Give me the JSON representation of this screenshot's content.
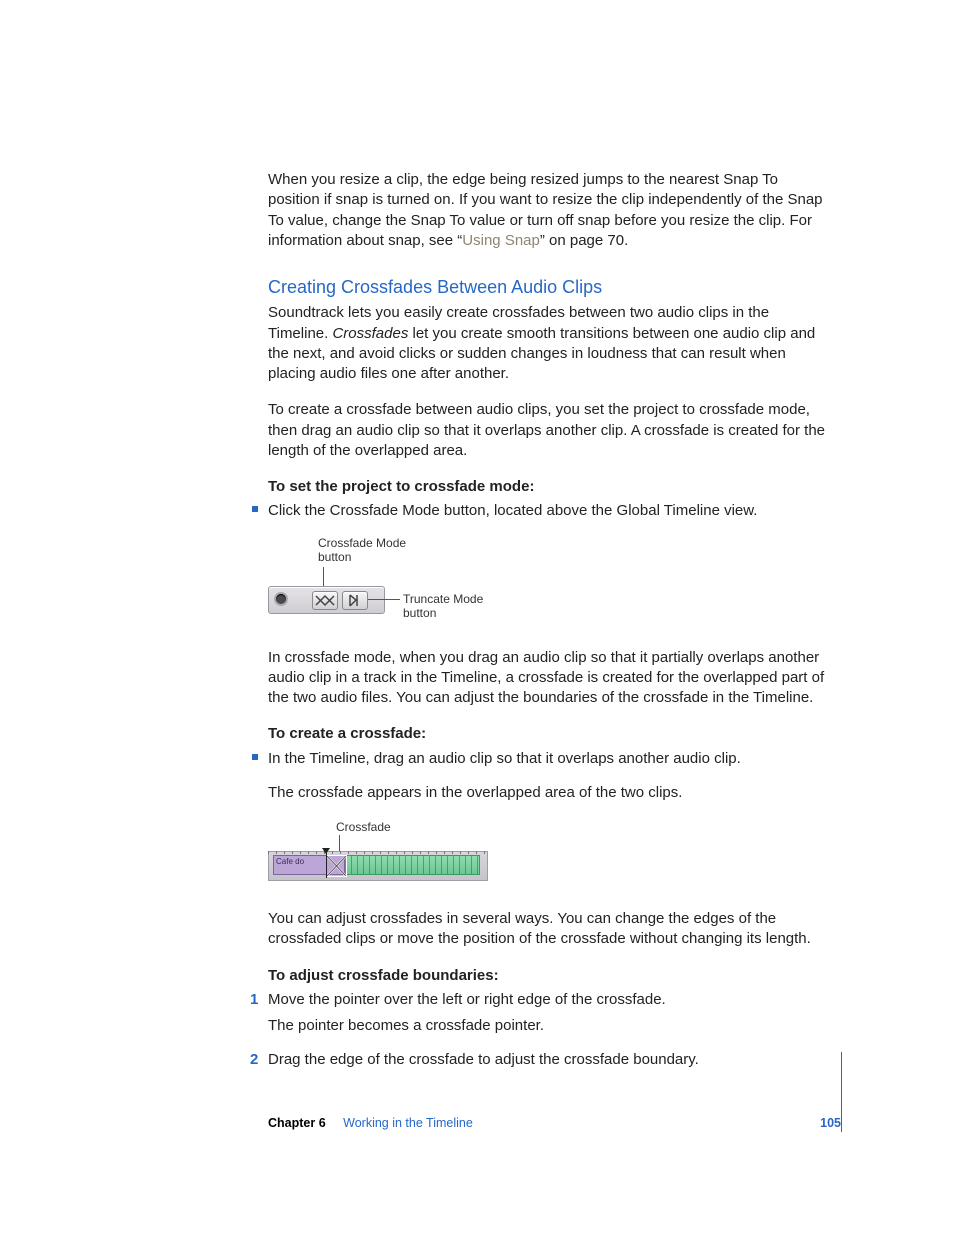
{
  "intro": {
    "p1a": "When you resize a clip, the edge being resized jumps to the nearest Snap To position if snap is turned on. If you want to resize the clip independently of the Snap To value, change the Snap To value or turn off snap before you resize the clip. For information about snap, see “",
    "p1link": "Using Snap",
    "p1b": "” on page 70."
  },
  "heading": "Creating Crossfades Between Audio Clips",
  "p2a": "Soundtrack lets you easily create crossfades between two audio clips in the Timeline. ",
  "p2em": "Crossfades",
  "p2b": " let you create smooth transitions between one audio clip and the next, and avoid clicks or sudden changes in loudness that can result when placing audio files one after another.",
  "p3": "To create a crossfade between audio clips, you set the project to crossfade mode, then drag an audio clip so that it overlaps another clip. A crossfade is created for the length of the overlapped area.",
  "inst1_head": "To set the project to crossfade mode:",
  "inst1_item": "Click the Crossfade Mode button, located above the Global Timeline view.",
  "fig1": {
    "label_crossfade": "Crossfade Mode button",
    "label_truncate": "Truncate Mode button"
  },
  "p4": "In crossfade mode, when you drag an audio clip so that it partially overlaps another audio clip in a track in the Timeline, a crossfade is created for the overlapped part of the two audio files. You can adjust the boundaries of the crossfade in the Timeline.",
  "inst2_head": "To create a crossfade:",
  "inst2_item": "In the Timeline, drag an audio clip so that it overlaps another audio clip.",
  "p5": "The crossfade appears in the overlapped area of the two clips.",
  "fig2": {
    "label": "Crossfade",
    "clipA_name": "Cafe do"
  },
  "p6": "You can adjust crossfades in several ways. You can change the edges of the crossfaded clips or move the position of the crossfade without changing its length.",
  "inst3_head": "To adjust crossfade boundaries:",
  "step1": "Move the pointer over the left or right edge of the crossfade.",
  "step1b": "The pointer becomes a crossfade pointer.",
  "step2": "Drag the edge of the crossfade to adjust the crossfade boundary.",
  "footer": {
    "chapter_label": "Chapter 6",
    "chapter_title": "Working in the Timeline",
    "page_number": "105"
  }
}
